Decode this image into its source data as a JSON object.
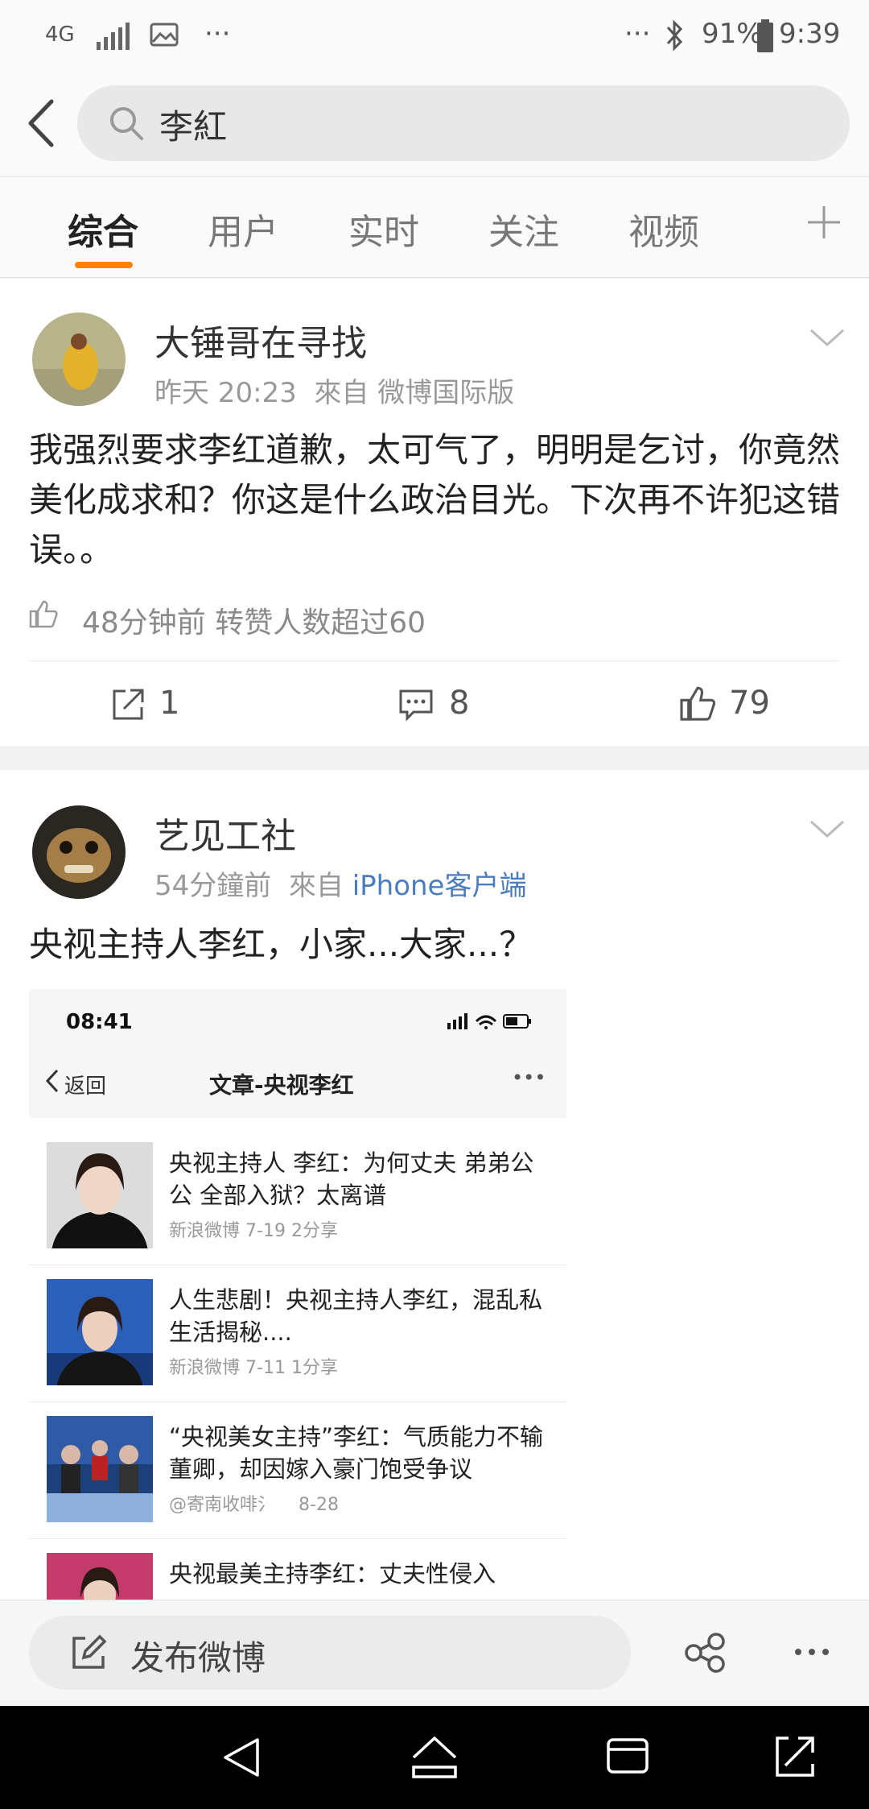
{
  "status_bar": {
    "network": "4G",
    "right_dots": "···",
    "left_dots": "···",
    "battery": "91%",
    "time": "9:39"
  },
  "search": {
    "query": "李紅"
  },
  "tabs": [
    {
      "label": "综合",
      "active": true
    },
    {
      "label": "用户",
      "active": false
    },
    {
      "label": "实时",
      "active": false
    },
    {
      "label": "关注",
      "active": false
    },
    {
      "label": "视频",
      "active": false
    }
  ],
  "post1": {
    "username": "大锤哥在寻找",
    "time": "昨天 20:23",
    "source_prefix": "來自",
    "source": "微博国际版",
    "text": "我强烈要求李红道歉，太可气了，明明是乞讨，你竟然美化成求和？你这是什么政治目光。下次再不许犯这错误。。",
    "like_hint": "48分钟前 转赞人数超过60",
    "reposts": "1",
    "comments": "8",
    "likes": "79"
  },
  "post2": {
    "username": "艺见工社",
    "time": "54分鐘前",
    "source_prefix": "來自",
    "source": "iPhone客户端",
    "text": "央视主持人李红，小家...大家...？",
    "embedded": {
      "time": "08:41",
      "back_label": "返回",
      "title": "文章-央视李红",
      "more": "•••",
      "articles": [
        {
          "title": "央视主持人 李红：为何丈夫 弟弟公公 全部入狱？太离谱",
          "source": "新浪微博",
          "date": "7-19",
          "shares": "2分享"
        },
        {
          "title": "人生悲剧！央视主持人李红，混乱私生活揭秘....",
          "source": "新浪微博",
          "date": "7-11",
          "shares": "1分享"
        },
        {
          "title": "“央视美女主持”李红：气质能力不输董卿，却因嫁入豪门饱受争议",
          "source": "@寄南收啡氵",
          "date": "8-28",
          "shares": ""
        },
        {
          "title": "央视最美主持李红：丈夫性侵入",
          "source": "",
          "date": "",
          "shares": ""
        }
      ]
    }
  },
  "compose": {
    "label": "发布微博"
  },
  "colors": {
    "accent": "#ff8200",
    "link": "#4b7cbd"
  }
}
